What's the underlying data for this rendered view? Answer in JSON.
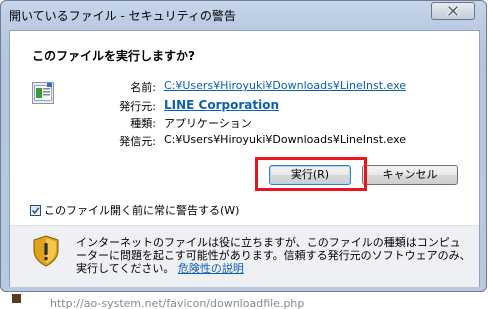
{
  "window": {
    "title": "開いているファイル - セキュリティの警告"
  },
  "dialog": {
    "heading": "このファイルを実行しますか?",
    "fields": [
      {
        "label": "名前:",
        "value": "C:¥Users¥Hiroyuki¥Downloads¥LineInst.exe"
      },
      {
        "label": "発行元:",
        "value": "LINE Corporation"
      },
      {
        "label": "種類:",
        "value": "アプリケーション"
      },
      {
        "label": "発信元:",
        "value": "C:¥Users¥Hiroyuki¥Downloads¥LineInst.exe"
      }
    ],
    "run_button": "実行(R)",
    "cancel_button": "キャンセル",
    "checkbox_label": "このファイル開く前に常に警告する(W)",
    "checkbox_checked": true,
    "warning_text": "インターネットのファイルは役に立ちますが、このファイルの種類はコンピューターに問題を起こす可能性があります。信頼する発行元のソフトウェアのみ、実行してください。",
    "warning_link": "危険性の説明"
  },
  "background": {
    "url_text": "http://ao-system.net/favicon/downloadfile.php"
  },
  "colors": {
    "link": "#0b5fb5",
    "highlight": "#e8151f",
    "title_bar": "#bccde4"
  }
}
